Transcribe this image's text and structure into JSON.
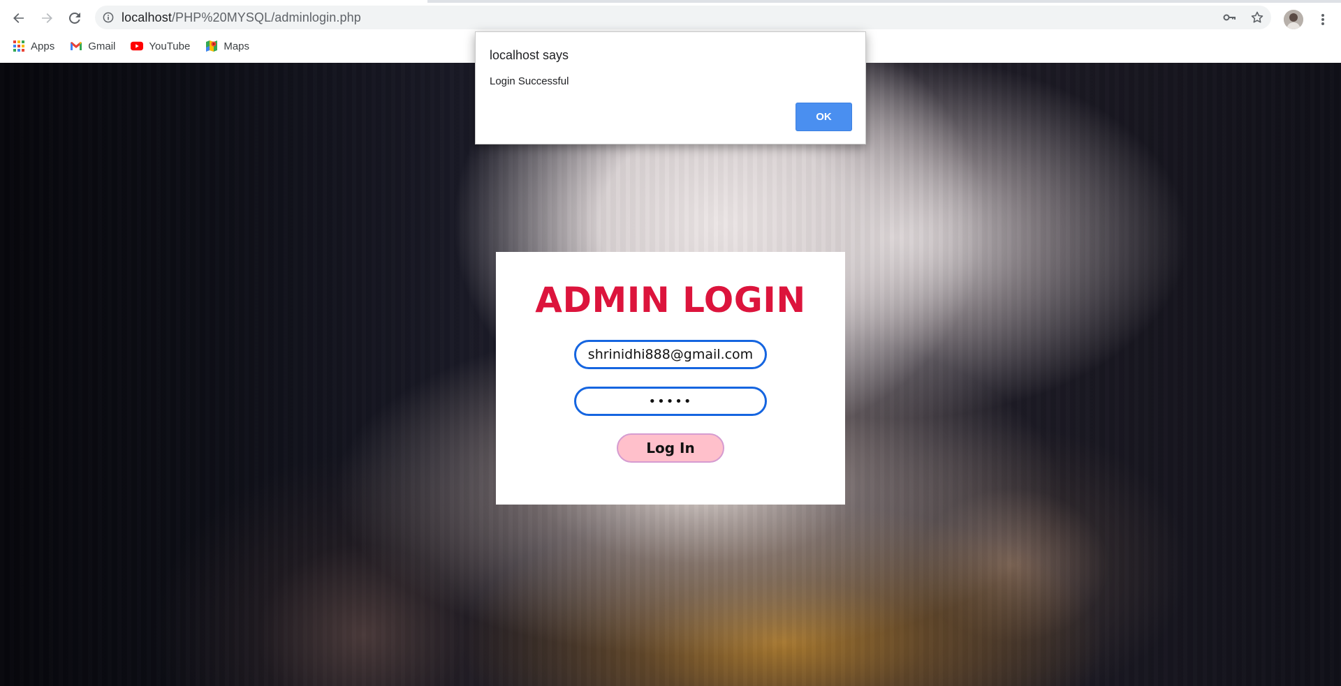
{
  "browser": {
    "url_host": "localhost",
    "url_path": "/PHP%20MYSQL/adminlogin.php",
    "bookmarks": [
      {
        "label": "Apps",
        "icon": "apps-grid-icon"
      },
      {
        "label": "Gmail",
        "icon": "gmail-icon"
      },
      {
        "label": "YouTube",
        "icon": "youtube-icon"
      },
      {
        "label": "Maps",
        "icon": "maps-icon"
      }
    ]
  },
  "login": {
    "title": "ADMIN LOGIN",
    "email_value": "shrinidhi888@gmail.com",
    "password_value": "•••••",
    "button_label": "Log In",
    "colors": {
      "title": "#dc143c",
      "field_border": "#1565e0",
      "button_bg": "#ffc0cb"
    }
  },
  "alert": {
    "title": "localhost says",
    "message": "Login Successful",
    "ok_label": "OK"
  }
}
